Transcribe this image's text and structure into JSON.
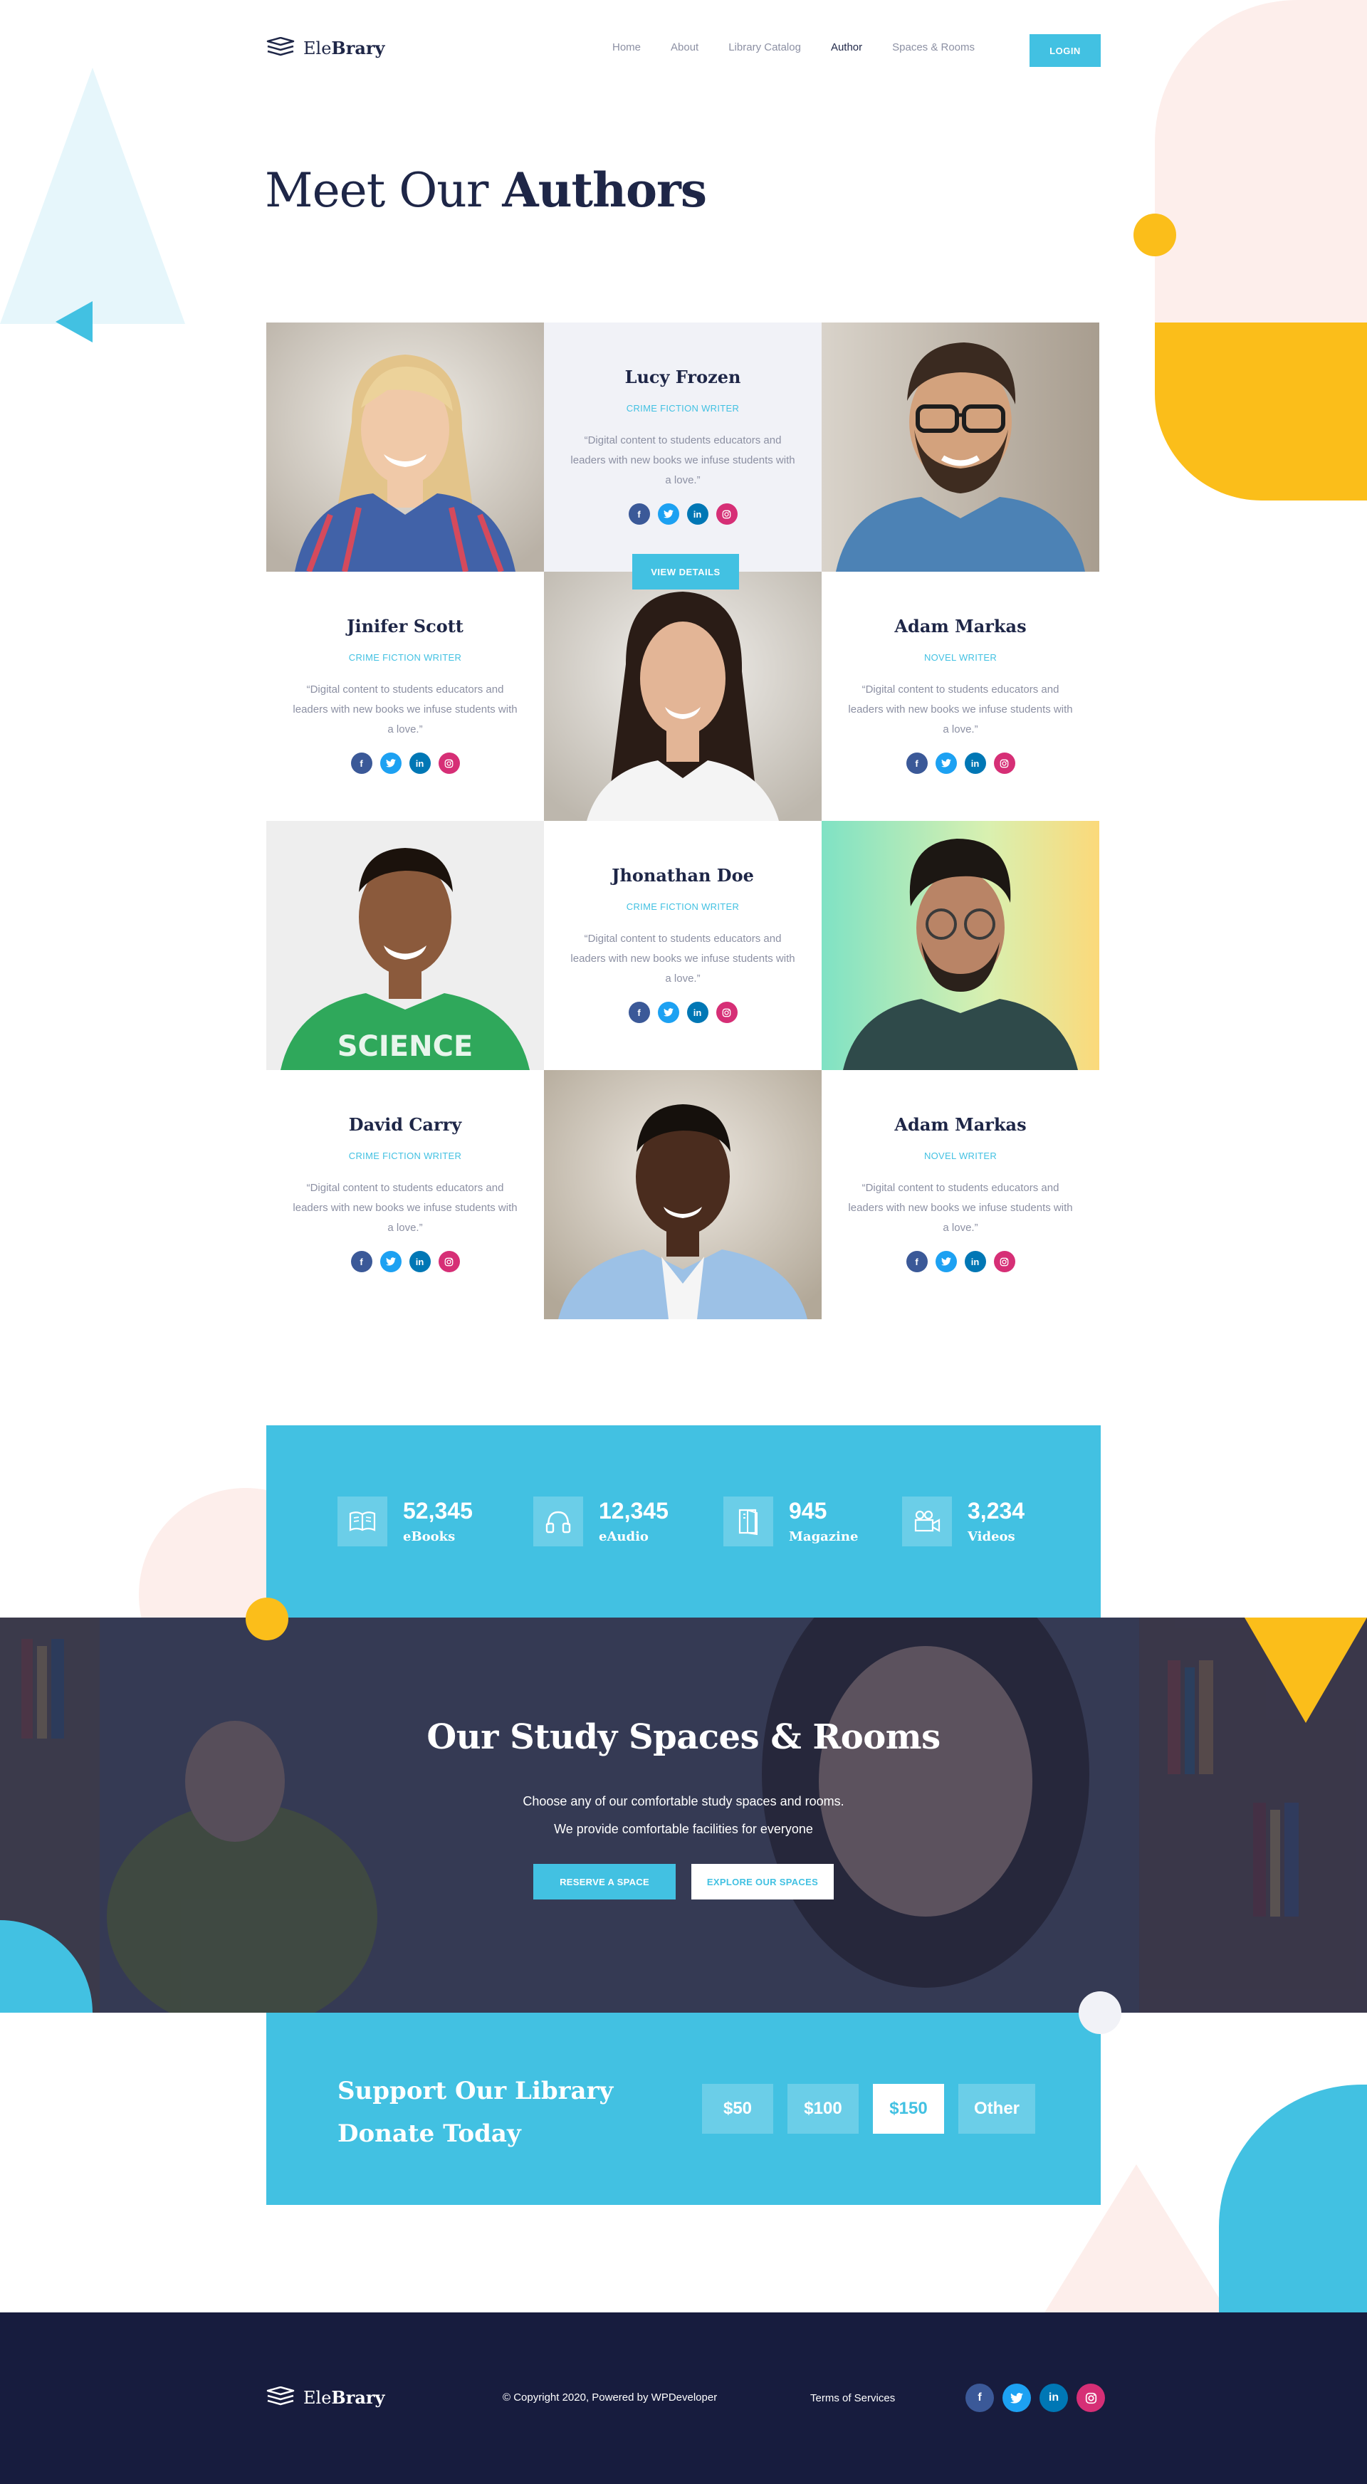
{
  "brand": {
    "name_light": "Ele",
    "name_bold": "Brary"
  },
  "nav": {
    "items": [
      {
        "label": "Home",
        "active": false
      },
      {
        "label": "About",
        "active": false
      },
      {
        "label": "Library Catalog",
        "active": false
      },
      {
        "label": "Author",
        "active": true
      },
      {
        "label": "Spaces & Rooms",
        "active": false
      }
    ],
    "login_label": "LOGIN"
  },
  "page": {
    "title_light": "Meet Our",
    "title_bold": "Authors"
  },
  "authors": [
    {
      "name": "Lucy Frozen",
      "role": "CRIME FICTION WRITER",
      "quote": "“Digital content to students educators and leaders with new books we infuse students with a love.”"
    },
    {
      "name": "Jinifer Scott",
      "role": "CRIME FICTION WRITER",
      "quote": "“Digital content to students educators and leaders with new books we infuse students with a love.”"
    },
    {
      "name": "Adam Markas",
      "role": "NOVEL WRITER",
      "quote": "“Digital content to students educators and leaders with new books we infuse students with a love.”"
    },
    {
      "name": "Jhonathan Doe",
      "role": "CRIME FICTION WRITER",
      "quote": "“Digital content to students educators and leaders with new books we infuse students with a love.”"
    },
    {
      "name": "David Carry",
      "role": "CRIME FICTION WRITER",
      "quote": "“Digital content to students educators and leaders with new books we infuse students with a love.”"
    },
    {
      "name": "Adam Markas",
      "role": "NOVEL WRITER",
      "quote": "“Digital content to students educators and leaders with new books we infuse students with a love.”"
    }
  ],
  "view_details_label": "VIEW DETAILS",
  "social_icons": {
    "facebook": "f",
    "twitter": "t",
    "linkedin": "in",
    "instagram": "ig"
  },
  "stats": [
    {
      "icon": "book-icon",
      "value": "52,345",
      "label": "eBooks"
    },
    {
      "icon": "headphones-icon",
      "value": "12,345",
      "label": "eAudio"
    },
    {
      "icon": "magazine-icon",
      "value": "945",
      "label": "Magazine"
    },
    {
      "icon": "video-camera-icon",
      "value": "3,234",
      "label": "Videos"
    }
  ],
  "study": {
    "title": "Our Study Spaces & Rooms",
    "line1": "Choose any of our comfortable study spaces and rooms.",
    "line2": "We provide comfortable facilities for everyone",
    "reserve_label": "RESERVE A SPACE",
    "explore_label": "EXPLORE OUR SPACES"
  },
  "donate": {
    "line1": "Support Our Library",
    "line2": "Donate Today",
    "options": [
      {
        "label": "$50",
        "selected": false
      },
      {
        "label": "$100",
        "selected": false
      },
      {
        "label": "$150",
        "selected": true
      },
      {
        "label": "Other",
        "selected": false
      }
    ]
  },
  "footer": {
    "copyright": "© Copyright 2020, Powered by WPDeveloper",
    "terms": "Terms of Services"
  },
  "colors": {
    "accent": "#42c1e2",
    "navy": "#1e2647",
    "footer_bg": "#171c3e",
    "yellow": "#fbbe1a",
    "pink": "#fdeeeb",
    "muted_text": "#8c90a3"
  }
}
